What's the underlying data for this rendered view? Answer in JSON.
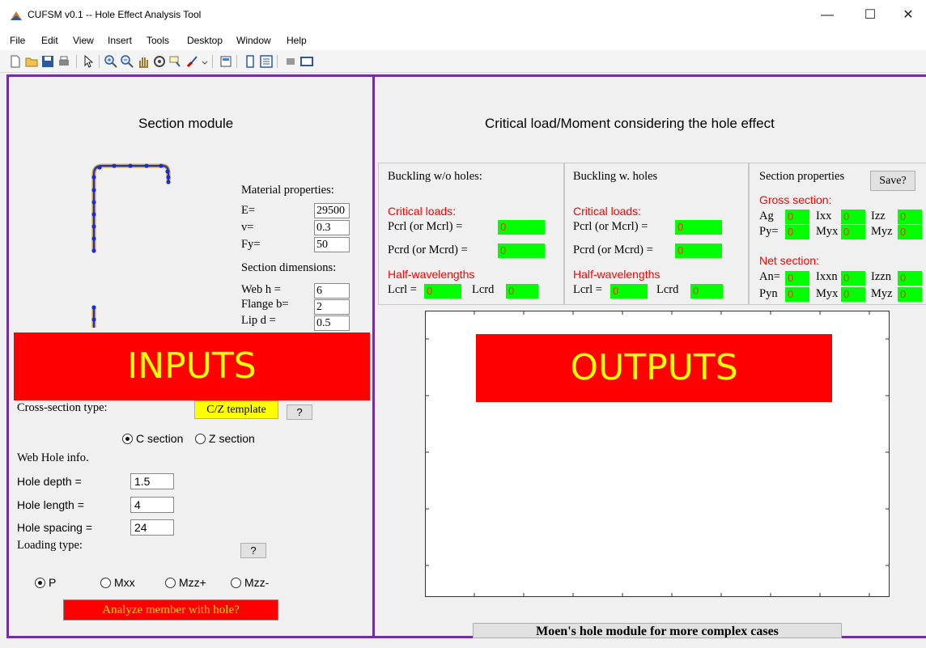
{
  "window": {
    "title": "CUFSM v0.1 -- Hole Effect Analysis Tool",
    "minimize": "—",
    "maximize": "☐",
    "close": "✕"
  },
  "menu": [
    "File",
    "Edit",
    "View",
    "Insert",
    "Tools",
    "Desktop",
    "Window",
    "Help"
  ],
  "toolbar_icons": [
    "new-file-icon",
    "open-folder-icon",
    "save-icon",
    "print-icon",
    "pointer-icon",
    "zoom-in-icon",
    "zoom-out-icon",
    "pan-hand-icon",
    "rotate-3d-icon",
    "data-cursor-icon",
    "brush-icon",
    "link-icon",
    "insert-colorbar-icon",
    "insert-legend-icon",
    "hide-plot-tools-icon",
    "show-plot-tools-icon"
  ],
  "inputs": {
    "section_title": "Section module",
    "material_label": "Material properties:",
    "E_label": "E=",
    "E_value": "29500",
    "v_label": "v=",
    "v_value": "0.3",
    "Fy_label": "Fy=",
    "Fy_value": "50",
    "dims_label": "Section dimensions:",
    "web_label": "Web h =",
    "web_value": "6",
    "flange_label": "Flange b=",
    "flange_value": "2",
    "lip_label": "Lip d =",
    "lip_value": "0.5",
    "overlay_text": "INPUTS",
    "cs_type_label": "Cross-section type:",
    "template_btn": "C/Z template",
    "help_btn": "?",
    "c_section": "C section",
    "z_section": "Z section",
    "web_hole_label": "Web Hole info.",
    "hole_depth_label": "Hole depth =",
    "hole_depth_value": "1.5",
    "hole_length_label": "Hole length =",
    "hole_length_value": "4",
    "hole_spacing_label": "Hole spacing =",
    "hole_spacing_value": "24",
    "loading_label": "Loading type:",
    "loading_help": "?",
    "load_P": "P",
    "load_Mxx": "Mxx",
    "load_Mzz_plus": "Mzz+",
    "load_Mzz_minus": "Mzz-",
    "analyze_btn": "Analyze member with hole?"
  },
  "outputs": {
    "title": "Critical load/Moment considering the hole effect",
    "overlay_text": "OUTPUTS",
    "moen_btn": "Moen's hole module for more complex cases",
    "box1": {
      "title": "Buckling w/o holes:",
      "critical": "Critical loads:",
      "pcrl": "Pcrl (or Mcrl) =",
      "pcrl_val": "0",
      "pcrd": "Pcrd (or Mcrd) =",
      "pcrd_val": "0",
      "half": "Half-wavelengths",
      "lcrl": "Lcrl =",
      "lcrl_val": "0",
      "lcrd": "Lcrd",
      "lcrd_val": "0"
    },
    "box2": {
      "title": "Buckling w. holes",
      "critical": "Critical loads:",
      "pcrl": "Pcrl (or Mcrl) =",
      "pcrl_val": "0",
      "pcrd": "Pcrd (or Mcrd) =",
      "pcrd_val": "0",
      "half": "Half-wavelengths",
      "lcrl": "Lcrl =",
      "lcrl_val": "0",
      "lcrd": "Lcrd",
      "lcrd_val": "0"
    },
    "box3": {
      "title": "Section properties",
      "save_btn": "Save?",
      "gross": "Gross section:",
      "ag": "Ag",
      "ag_val": "0",
      "ixx": "Ixx",
      "ixx_val": "0",
      "izz": "Izz",
      "izz_val": "0",
      "py": "Py=",
      "py_val": "0",
      "myx": "Myx",
      "myx_val": "0",
      "myz": "Myz",
      "myz_val": "0",
      "net": "Net section:",
      "an": "An=",
      "an_val": "0",
      "ixxn": "Ixxn",
      "ixxn_val": "0",
      "izzn": "Izzn",
      "izzn_val": "0",
      "pyn": "Pyn",
      "pyn_val": "0",
      "myx2": "Myx",
      "myx2_val": "0",
      "myz2": "Myz",
      "myz2_val": "0"
    }
  }
}
